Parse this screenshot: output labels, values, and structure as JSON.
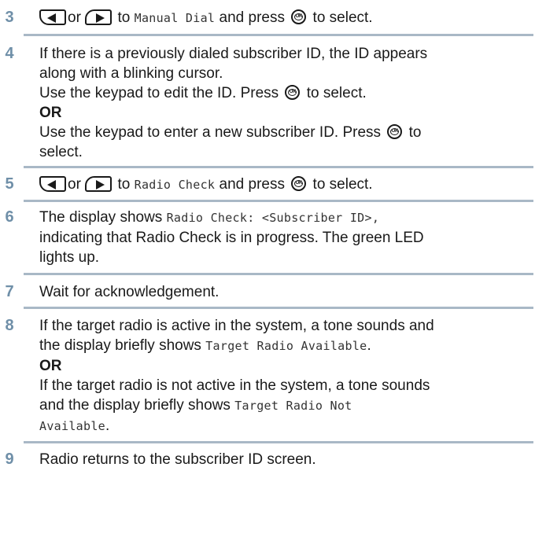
{
  "steps": [
    {
      "number": "3",
      "lines": [
        {
          "or": "or",
          "to": "to",
          "target": "Manual Dial",
          "press": "and press",
          "select": "to select."
        }
      ]
    },
    {
      "number": "4",
      "lines": [
        "If there is a previously dialed subscriber ID, the ID appears",
        "along with a blinking cursor.",
        "Use the keypad to edit the ID. Press",
        "to select.",
        "OR",
        "Use the keypad to enter a new subscriber ID. Press",
        "to",
        "select."
      ]
    },
    {
      "number": "5",
      "lines": [
        {
          "or": "or",
          "to": "to",
          "target": "Radio Check",
          "press": "and press",
          "select": "to select."
        }
      ]
    },
    {
      "number": "6",
      "lines": [
        "The display shows",
        "Radio Check: <Subscriber ID>,",
        "indicating that Radio Check is in progress. The green LED",
        "lights up."
      ]
    },
    {
      "number": "7",
      "lines": [
        "Wait for acknowledgement."
      ]
    },
    {
      "number": "8",
      "lines": [
        "If the target radio is active in the system, a tone sounds and",
        "the display briefly shows",
        "Target Radio Available",
        ".",
        "OR",
        "If the target radio is not active in the system, a tone sounds",
        "and the display briefly shows",
        "Target Radio Not",
        "Available",
        "."
      ]
    },
    {
      "number": "9",
      "lines": [
        "Radio returns to the subscriber ID screen."
      ]
    }
  ],
  "icons": {
    "ok_key_label": "OK",
    "left_key": "left-arrow-key-icon",
    "right_key": "right-arrow-key-icon",
    "ok_key": "ok-key-icon"
  },
  "colors": {
    "step_number": "#6f8fa8",
    "rule": "#a9b8c6",
    "text": "#1a1a1a"
  }
}
